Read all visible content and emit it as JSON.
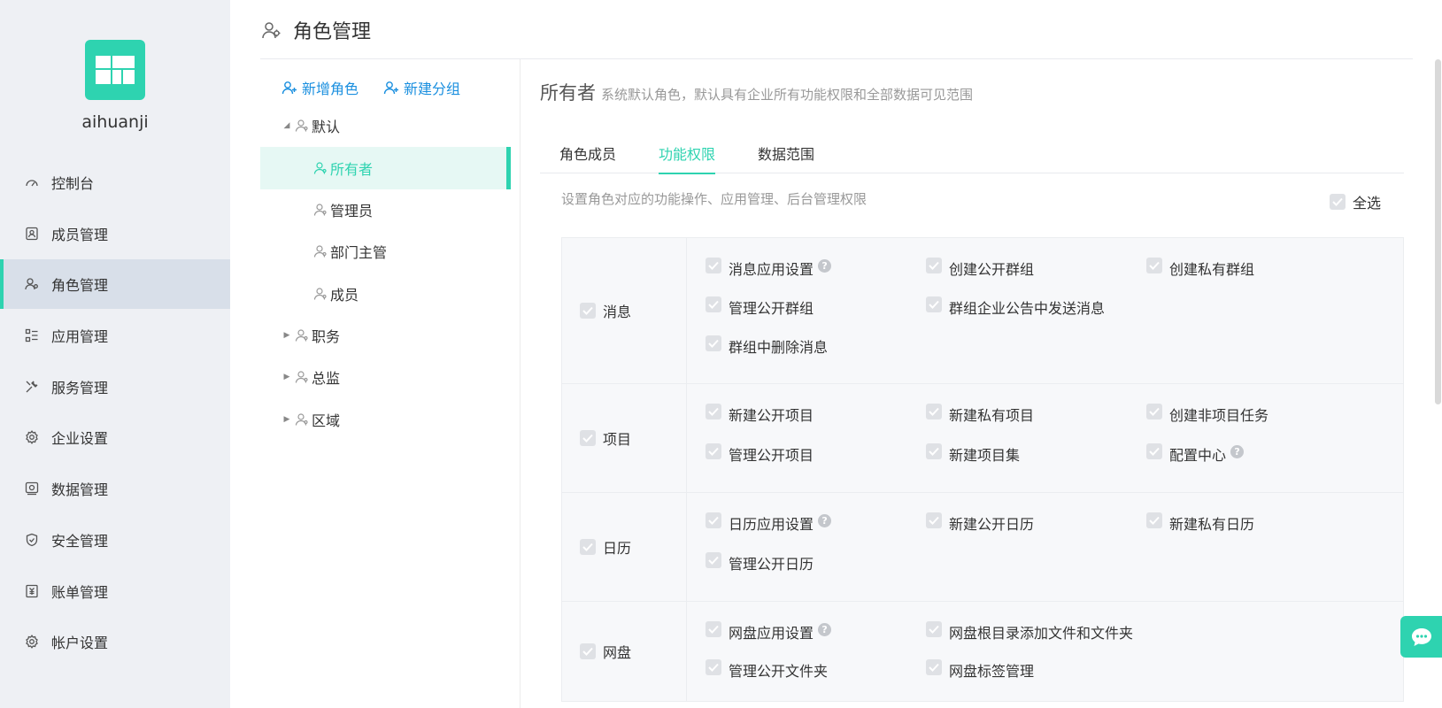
{
  "brand": {
    "name": "aihuanji",
    "accent": "#2ed3b0"
  },
  "sidebar": {
    "items": [
      {
        "label": "控制台",
        "icon": "dashboard-icon"
      },
      {
        "label": "成员管理",
        "icon": "member-icon"
      },
      {
        "label": "角色管理",
        "icon": "role-icon",
        "active": true
      },
      {
        "label": "应用管理",
        "icon": "app-list-icon"
      },
      {
        "label": "服务管理",
        "icon": "tools-icon"
      },
      {
        "label": "企业设置",
        "icon": "gear-icon"
      },
      {
        "label": "数据管理",
        "icon": "data-icon"
      },
      {
        "label": "安全管理",
        "icon": "shield-icon"
      },
      {
        "label": "账单管理",
        "icon": "bill-icon"
      },
      {
        "label": "帐户设置",
        "icon": "gear-icon"
      }
    ]
  },
  "header": {
    "title": "角色管理"
  },
  "tree": {
    "add_role": "新增角色",
    "add_group": "新建分组",
    "nodes": [
      {
        "label": "默认",
        "level": 0,
        "expanded": true
      },
      {
        "label": "所有者",
        "level": 1,
        "selected": true
      },
      {
        "label": "管理员",
        "level": 1
      },
      {
        "label": "部门主管",
        "level": 1
      },
      {
        "label": "成员",
        "level": 1
      },
      {
        "label": "职务",
        "level": 0,
        "expanded": false
      },
      {
        "label": "总监",
        "level": 0,
        "expanded": false
      },
      {
        "label": "区域",
        "level": 0,
        "expanded": false
      }
    ]
  },
  "detail": {
    "role_name": "所有者",
    "role_desc": "系统默认角色，默认具有企业所有功能权限和全部数据可见范围",
    "tabs": [
      {
        "label": "角色成员"
      },
      {
        "label": "功能权限",
        "active": true
      },
      {
        "label": "数据范围"
      }
    ],
    "hint": "设置角色对应的功能操作、应用管理、后台管理权限",
    "select_all": "全选",
    "permissions": [
      {
        "category": "消息",
        "items": [
          {
            "label": "消息应用设置",
            "help": true
          },
          {
            "label": "创建公开群组"
          },
          {
            "label": "创建私有群组"
          },
          {
            "label": "管理公开群组"
          },
          {
            "label": "群组企业公告中发送消息"
          },
          {
            "label": "",
            "spacer": true
          },
          {
            "label": "群组中删除消息"
          }
        ]
      },
      {
        "category": "项目",
        "items": [
          {
            "label": "新建公开项目"
          },
          {
            "label": "新建私有项目"
          },
          {
            "label": "创建非项目任务"
          },
          {
            "label": "管理公开项目"
          },
          {
            "label": "新建项目集"
          },
          {
            "label": "配置中心",
            "help": true
          }
        ]
      },
      {
        "category": "日历",
        "items": [
          {
            "label": "日历应用设置",
            "help": true
          },
          {
            "label": "新建公开日历"
          },
          {
            "label": "新建私有日历"
          },
          {
            "label": "管理公开日历"
          }
        ]
      },
      {
        "category": "网盘",
        "items": [
          {
            "label": "网盘应用设置",
            "help": true
          },
          {
            "label": "网盘根目录添加文件和文件夹"
          },
          {
            "label": "",
            "spacer": true
          },
          {
            "label": "管理公开文件夹"
          },
          {
            "label": "网盘标签管理"
          }
        ]
      }
    ]
  }
}
